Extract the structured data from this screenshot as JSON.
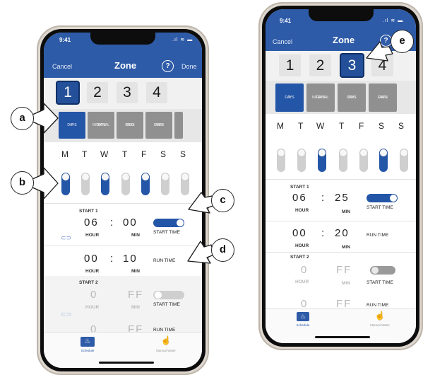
{
  "status_time": "9:41",
  "status_icons": ".ıl ≋ ▬",
  "header": {
    "cancel": "Cancel",
    "title": "Zone",
    "help": "?",
    "done": "Done"
  },
  "zones": [
    "1",
    "2",
    "3",
    "4"
  ],
  "modes": [
    {
      "line1": "7",
      "line2": "DAYS"
    },
    {
      "line1": "INTERVAL",
      "line2": "DAYS"
    },
    {
      "line1": "ODD",
      "line2": "DAYS"
    },
    {
      "line1": "EVEN",
      "line2": "DAYS"
    }
  ],
  "days": [
    "M",
    "T",
    "W",
    "T",
    "F",
    "S",
    "S"
  ],
  "left_phone": {
    "selected_zone": "1",
    "selected_mode": "7 DAYS",
    "day_toggles_on": [
      true,
      false,
      true,
      false,
      true,
      false,
      false
    ],
    "start1": {
      "label": "START 1",
      "hour": "06",
      "colon": ":",
      "min": "00",
      "hour_unit": "HOUR",
      "min_unit": "MIN",
      "start_time_label": "START TIME",
      "start_time_on": true
    },
    "run1": {
      "hour": "00",
      "colon": ":",
      "min": "10",
      "hour_unit": "HOUR",
      "min_unit": "MIN",
      "label": "RUN TIME"
    },
    "start2": {
      "label": "START 2",
      "hour": "0",
      "min": "FF",
      "hour_unit": "HOUR",
      "min_unit": "MIN",
      "start_time_label": "START TIME",
      "start_time_on": false
    },
    "run2": {
      "hour": "0",
      "min": "FF",
      "label": "RUN TIME"
    }
  },
  "right_phone": {
    "selected_zone": "3",
    "selected_mode": "7 DAYS",
    "day_toggles_on": [
      false,
      false,
      true,
      false,
      false,
      true,
      false
    ],
    "start1": {
      "label": "START 1",
      "hour": "06",
      "colon": ":",
      "min": "25",
      "hour_unit": "HOUR",
      "min_unit": "MIN",
      "start_time_label": "START TIME",
      "start_time_on": true
    },
    "run1": {
      "hour": "00",
      "colon": ":",
      "min": "20",
      "hour_unit": "HOUR",
      "min_unit": "MIN",
      "label": "RUN TIME"
    },
    "start2": {
      "label": "START 2",
      "hour": "0",
      "min": "FF",
      "hour_unit": "HOUR",
      "min_unit": "MIN",
      "start_time_label": "START TIME",
      "start_time_on": false
    },
    "run2": {
      "hour": "0",
      "min": "FF",
      "label": "RUN TIME"
    }
  },
  "tabbar": {
    "schedule": "Schedule",
    "manual": "Manual Water",
    "schedule_icon": "sprinkler-icon",
    "manual_icon": "hand-pointer-icon"
  },
  "callouts": {
    "a": "a",
    "b": "b",
    "c": "c",
    "d": "d",
    "e": "e"
  },
  "colors": {
    "header_blue": "#2e5ba8",
    "selected_blue": "#24509a",
    "inactive_gray": "#909090"
  }
}
